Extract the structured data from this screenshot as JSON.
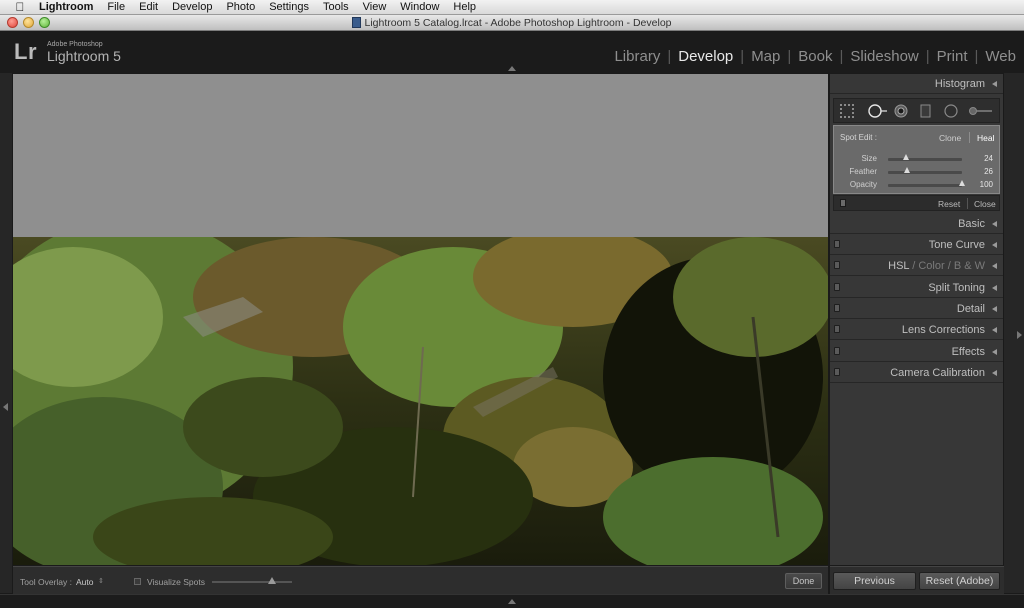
{
  "menubar": {
    "app_name": "Lightroom",
    "items": [
      "File",
      "Edit",
      "Develop",
      "Photo",
      "Settings",
      "Tools",
      "View",
      "Window",
      "Help"
    ]
  },
  "window": {
    "title": "Lightroom 5 Catalog.lrcat - Adobe Photoshop Lightroom - Develop"
  },
  "identity_plate": {
    "logo": "Lr",
    "line1": "Adobe Photoshop",
    "line2": "Lightroom 5"
  },
  "modules": [
    {
      "label": "Library",
      "active": false
    },
    {
      "label": "Develop",
      "active": true
    },
    {
      "label": "Map",
      "active": false
    },
    {
      "label": "Book",
      "active": false
    },
    {
      "label": "Slideshow",
      "active": false
    },
    {
      "label": "Print",
      "active": false
    },
    {
      "label": "Web",
      "active": false
    }
  ],
  "right_panel": {
    "histogram": "Histogram",
    "spot_edit": {
      "label": "Spot Edit :",
      "mode_clone": "Clone",
      "mode_heal": "Heal",
      "active_mode": "Heal",
      "sliders": [
        {
          "label": "Size",
          "value": "24",
          "fraction": 0.24
        },
        {
          "label": "Feather",
          "value": "26",
          "fraction": 0.26
        },
        {
          "label": "Opacity",
          "value": "100",
          "fraction": 1.0
        }
      ],
      "reset": "Reset",
      "close": "Close"
    },
    "panels": [
      {
        "label": "Basic"
      },
      {
        "label": "Tone Curve"
      },
      {
        "label": "HSL",
        "label2": "Color",
        "label3": "B & W"
      },
      {
        "label": "Split Toning"
      },
      {
        "label": "Detail"
      },
      {
        "label": "Lens Corrections"
      },
      {
        "label": "Effects"
      },
      {
        "label": "Camera Calibration"
      }
    ],
    "previous": "Previous",
    "reset_adobe": "Reset (Adobe)"
  },
  "toolbar": {
    "tool_overlay_label": "Tool Overlay :",
    "tool_overlay_value": "Auto",
    "visualize_spots": "Visualize Spots",
    "visualize_checked": false,
    "done": "Done"
  },
  "colors": {
    "canvas_bg": "#8f8f8f",
    "panel_bg": "#373737",
    "spot_panel_bg": "#6a6a6a",
    "active_module": "#e8e8e8"
  }
}
